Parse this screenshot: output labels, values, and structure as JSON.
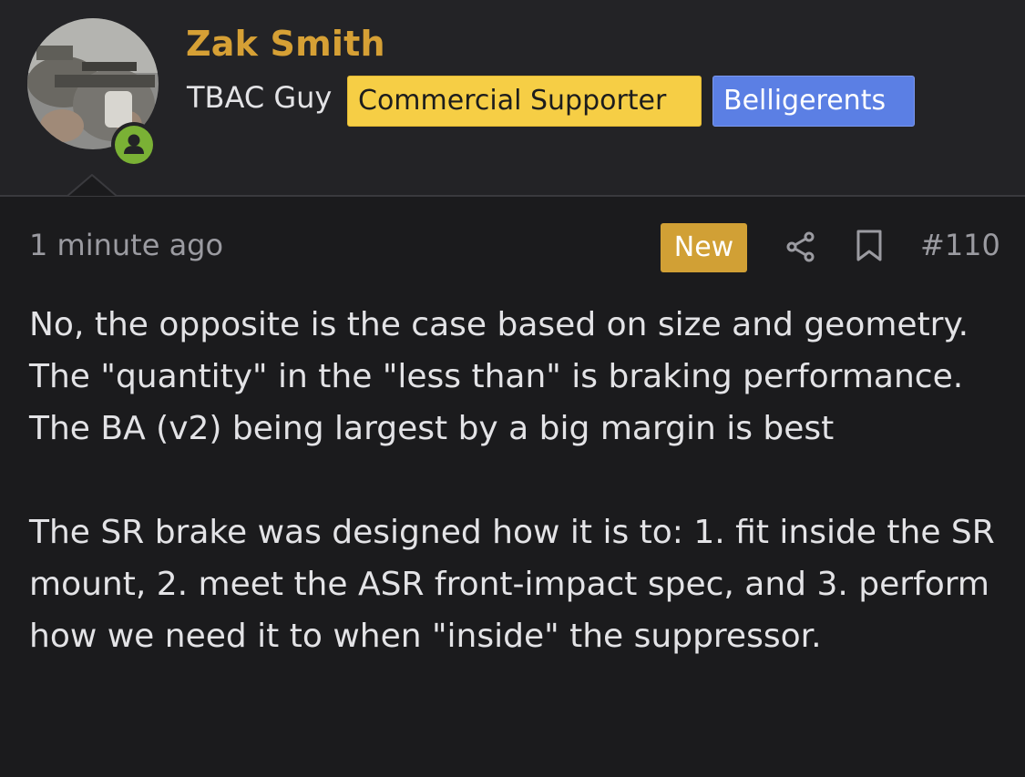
{
  "user": {
    "name": "Zak Smith",
    "user_title": "TBAC Guy",
    "banners": [
      "Commercial Supporter",
      "Belligerents"
    ],
    "online_status": "online",
    "avatar_icon": "avatar-photo",
    "online_icon": "user-online-icon"
  },
  "post": {
    "timestamp": "1 minute ago",
    "new_label": "New",
    "post_number": "#110",
    "actions": [
      "share-icon",
      "bookmark-icon"
    ],
    "paragraphs": [
      "No, the opposite is the case based on size and geometry. The \"quantity\" in the \"less than\" is braking performance. The BA (v2) being largest by a big margin is best",
      "The SR brake was designed how it is to: 1. fit inside the SR mount, 2. meet the ASR front-impact spec, and 3. perform how we need it to when \"inside\" the suppressor."
    ]
  },
  "colors": {
    "background": "#1b1b1d",
    "header_background": "#232326",
    "username": "#d6a035",
    "commercial_supporter_badge": "#f6ce45",
    "belligerents_badge": "#5b7fe4",
    "new_badge": "#d1a035",
    "online_dot": "#7ab135",
    "muted_text": "#9b9ba1"
  }
}
